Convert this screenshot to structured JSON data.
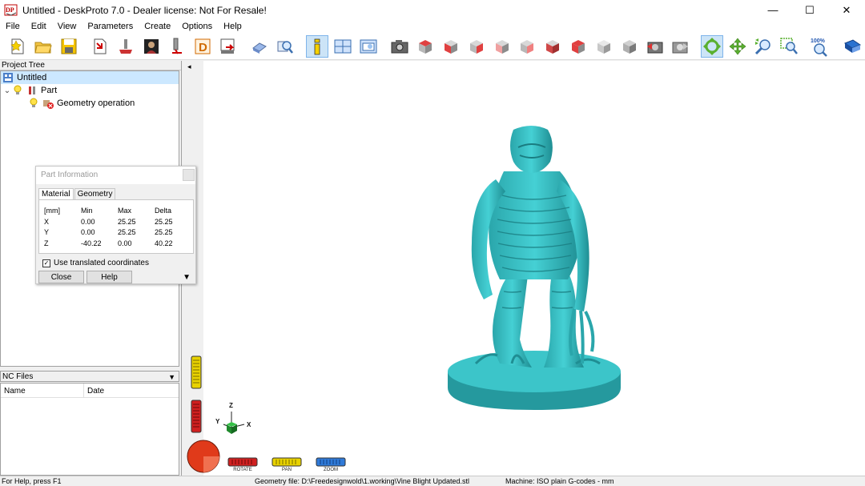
{
  "window": {
    "title": "Untitled - DeskProto 7.0 - Dealer license: Not For Resale!",
    "logo_text": "DP",
    "minimize": "—",
    "maximize": "☐",
    "close": "✕"
  },
  "menu": [
    "File",
    "Edit",
    "View",
    "Parameters",
    "Create",
    "Options",
    "Help"
  ],
  "toolbar": {
    "zoom_badge": "100%"
  },
  "project_tree": {
    "header": "Project Tree",
    "items": [
      {
        "label": "Untitled",
        "selected": true
      },
      {
        "label": "Part",
        "expander": "⌄"
      },
      {
        "label": "Geometry operation"
      }
    ]
  },
  "nc_files": {
    "header": "NC Files",
    "dropdown": "▼",
    "columns": [
      "Name",
      "Date"
    ]
  },
  "dialog": {
    "title": "Part Information",
    "tabs": [
      "Material",
      "Geometry"
    ],
    "table": {
      "headers": [
        "[mm]",
        "Min",
        "Max",
        "Delta"
      ],
      "rows": [
        [
          "X",
          "0.00",
          "25.25",
          "25.25"
        ],
        [
          "Y",
          "0.00",
          "25.25",
          "25.25"
        ],
        [
          "Z",
          "-40.22",
          "0.00",
          "40.22"
        ]
      ]
    },
    "checkbox_label": "Use translated coordinates",
    "checkbox_checked": true,
    "checkmark": "✓",
    "close_button": "Close",
    "help_button": "Help",
    "more": "▼"
  },
  "viewport": {
    "collapse_arrow": "◂",
    "axes": {
      "z": "Z",
      "y": "Y",
      "x": "X"
    },
    "controls": {
      "rotate": "ROTATE",
      "pan": "PAN",
      "zoom": "ZOOM"
    },
    "model_color": "#2fb8bc"
  },
  "status": {
    "help": "For Help, press F1",
    "geometry": "Geometry file: D:\\Freedesignwold\\1.working\\Vine Blight Updated.stl",
    "machine": "Machine: ISO plain G-codes - mm"
  }
}
